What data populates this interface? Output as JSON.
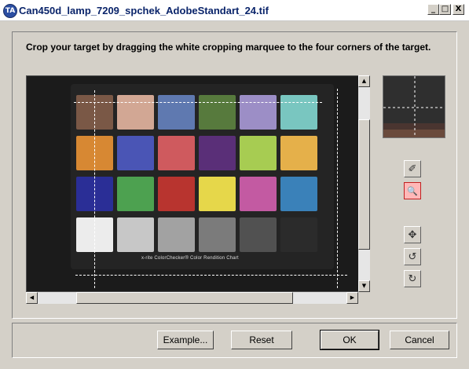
{
  "window": {
    "title": "Can450d_lamp_7209_spchek_AdobeStandart_24.tif",
    "icon_text": "TA",
    "controls": {
      "minimize": "_",
      "maximize": "□",
      "close": "X"
    }
  },
  "instruction": "Crop your target by dragging the white cropping marquee to the four corners of the target.",
  "target": {
    "label": "x-rite ColorChecker® Color Rendition Chart",
    "swatches": [
      "#7a5846",
      "#d2a794",
      "#5f79b0",
      "#577a3d",
      "#9c8ec6",
      "#79c6c0",
      "#d78833",
      "#4a55b5",
      "#cf5a5e",
      "#5a2f78",
      "#a7cc52",
      "#e5b04a",
      "#2a2e96",
      "#4da150",
      "#b8342f",
      "#e6d74a",
      "#c35aa2",
      "#3a81b9",
      "#ececec",
      "#c7c7c7",
      "#a2a2a2",
      "#7b7b7b",
      "#515151",
      "#2b2b2b"
    ]
  },
  "tools": [
    {
      "name": "eyedropper-icon",
      "glyph": "✐"
    },
    {
      "name": "zoom-icon",
      "glyph": "🔍"
    },
    {
      "name": "move-icon",
      "glyph": "✥"
    },
    {
      "name": "rotate-left-icon",
      "glyph": "↺"
    },
    {
      "name": "rotate-right-icon",
      "glyph": "↻"
    }
  ],
  "buttons": {
    "example": "Example...",
    "reset": "Reset",
    "ok": "OK",
    "cancel": "Cancel"
  },
  "scroll_glyphs": {
    "up": "▲",
    "down": "▼",
    "left": "◀",
    "right": "▶"
  }
}
